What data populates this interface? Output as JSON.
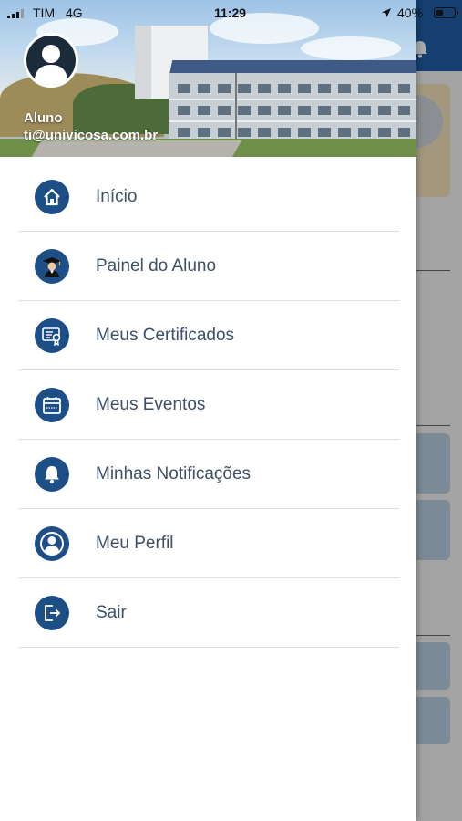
{
  "status_bar": {
    "carrier": "TIM",
    "network": "4G",
    "time": "11:29",
    "battery": "40%",
    "battery_level": 0.4
  },
  "user": {
    "name": "Aluno",
    "email": "ti@univicosa.com.br"
  },
  "menu": [
    {
      "label": "Início",
      "icon": "home-icon"
    },
    {
      "label": "Painel do Aluno",
      "icon": "graduate-icon"
    },
    {
      "label": "Meus Certificados",
      "icon": "certificate-icon"
    },
    {
      "label": "Meus Eventos",
      "icon": "calendar-icon"
    },
    {
      "label": "Minhas Notificações",
      "icon": "bell-icon"
    },
    {
      "label": "Meu Perfil",
      "icon": "profile-icon"
    },
    {
      "label": "Sair",
      "icon": "logout-icon"
    }
  ],
  "colors": {
    "accent": "#1d4f86",
    "topbar": "#1f5fa8",
    "menu_text": "#3d5068"
  }
}
